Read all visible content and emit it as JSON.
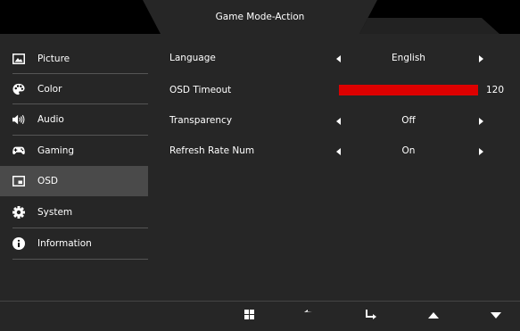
{
  "header": {
    "title": "Game Mode-Action"
  },
  "sidebar": {
    "items": [
      {
        "label": "Picture",
        "icon": "picture-icon",
        "active": false
      },
      {
        "label": "Color",
        "icon": "palette-icon",
        "active": false
      },
      {
        "label": "Audio",
        "icon": "speaker-icon",
        "active": false
      },
      {
        "label": "Gaming",
        "icon": "gamepad-icon",
        "active": false
      },
      {
        "label": "OSD",
        "icon": "osd-window-icon",
        "active": true
      },
      {
        "label": "System",
        "icon": "gear-icon",
        "active": false
      },
      {
        "label": "Information",
        "icon": "info-icon",
        "active": false
      }
    ]
  },
  "settings": {
    "language": {
      "label": "Language",
      "value": "English"
    },
    "osd_timeout": {
      "label": "OSD Timeout",
      "value": "120",
      "level": 1.0
    },
    "transparency": {
      "label": "Transparency",
      "value": "Off"
    },
    "refresh_rate_num": {
      "label": "Refresh Rate Num",
      "value": "On"
    }
  },
  "footer": {
    "buttons": [
      "menu-grid-icon",
      "back-icon",
      "enter-icon",
      "up-arrow-icon",
      "down-arrow-icon"
    ]
  },
  "colors": {
    "accent": "#dd0000",
    "panel": "#262626",
    "active_item": "#4a4a4a"
  }
}
